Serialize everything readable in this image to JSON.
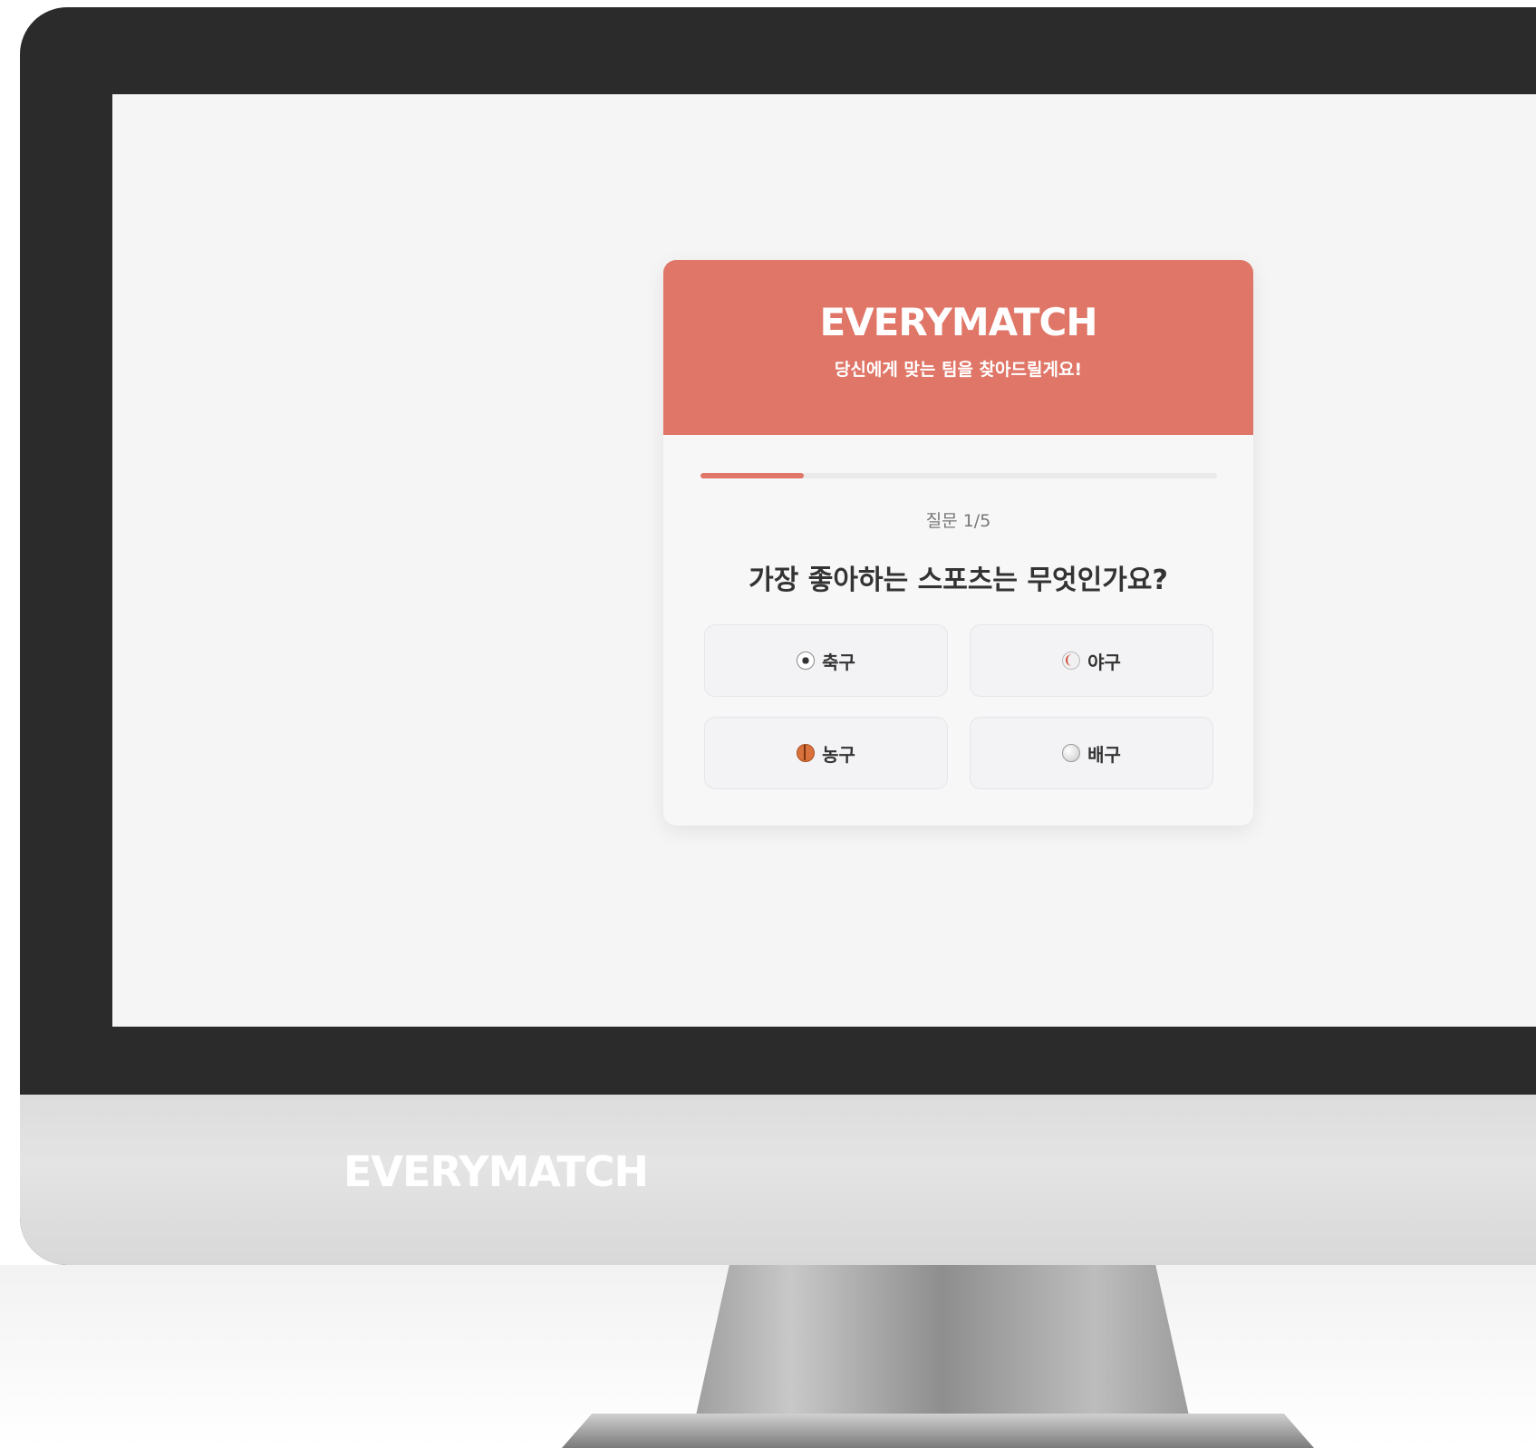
{
  "brand": {
    "name": "EVERYMATCH",
    "chin_name": "EVERYMATCH",
    "tagline": "당신에게 맞는 팀을 찾아드릴게요!"
  },
  "quiz": {
    "question_label": "질문 1/5",
    "question": "가장 좋아하는 스포츠는 무엇인가요?",
    "progress_fraction": 0.2,
    "options": [
      {
        "icon": "soccer-ball-icon",
        "label": "축구"
      },
      {
        "icon": "baseball-icon",
        "label": "야구"
      },
      {
        "icon": "basketball-icon",
        "label": "농구"
      },
      {
        "icon": "volleyball-icon",
        "label": "배구"
      }
    ]
  },
  "colors": {
    "accent": "#e07668",
    "screen_background": "#f5f5f5",
    "bezel": "#2b2b2b"
  }
}
